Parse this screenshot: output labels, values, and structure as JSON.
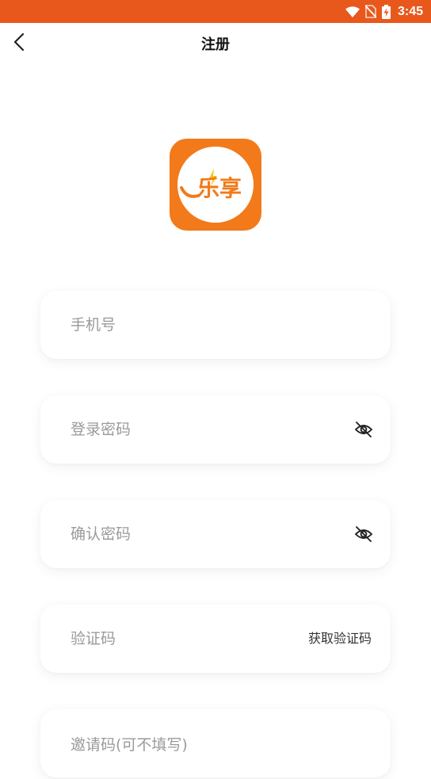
{
  "status_bar": {
    "time": "3:45",
    "color": "#e8581c",
    "icons": [
      "wifi-icon",
      "no-sim-icon",
      "battery-charging-icon"
    ]
  },
  "nav": {
    "back_icon": "chevron-left-icon",
    "title": "注册"
  },
  "logo": {
    "text": "乐享",
    "accent": "#f27a1a"
  },
  "form": {
    "phone": {
      "value": "",
      "placeholder": "手机号"
    },
    "password": {
      "value": "",
      "placeholder": "登录密码",
      "toggle_icon": "eye-off-icon"
    },
    "confirm_password": {
      "value": "",
      "placeholder": "确认密码",
      "toggle_icon": "eye-off-icon"
    },
    "verification_code": {
      "value": "",
      "placeholder": "验证码",
      "action_label": "获取验证码"
    },
    "invite_code": {
      "value": "",
      "placeholder": "邀请码(可不填写)"
    }
  }
}
